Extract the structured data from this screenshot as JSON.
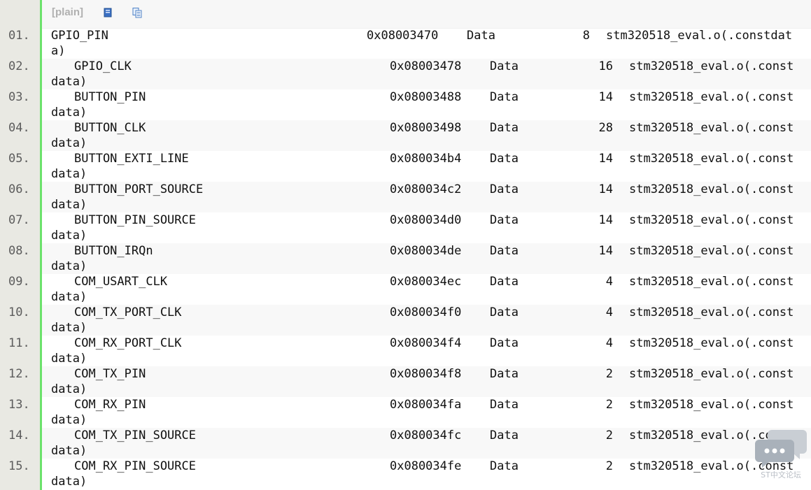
{
  "toolbar": {
    "label": "[plain]",
    "view_source_icon": "document-icon",
    "copy_icon": "copy-icon"
  },
  "lines": [
    {
      "num": "01.",
      "symbol": "GPIO_PIN",
      "addr": "0x08003470",
      "kind": "Data",
      "size": "8",
      "obj": "stm320518_eval.o(.constdat",
      "wrap": "a)"
    },
    {
      "num": "02.",
      "symbol": "GPIO_CLK",
      "addr": "0x08003478",
      "kind": "Data",
      "size": "16",
      "obj": "stm320518_eval.o(.const",
      "wrap": "data)"
    },
    {
      "num": "03.",
      "symbol": "BUTTON_PIN",
      "addr": "0x08003488",
      "kind": "Data",
      "size": "14",
      "obj": "stm320518_eval.o(.const",
      "wrap": "data)"
    },
    {
      "num": "04.",
      "symbol": "BUTTON_CLK",
      "addr": "0x08003498",
      "kind": "Data",
      "size": "28",
      "obj": "stm320518_eval.o(.const",
      "wrap": "data)"
    },
    {
      "num": "05.",
      "symbol": "BUTTON_EXTI_LINE",
      "addr": "0x080034b4",
      "kind": "Data",
      "size": "14",
      "obj": "stm320518_eval.o(.const",
      "wrap": "data)"
    },
    {
      "num": "06.",
      "symbol": "BUTTON_PORT_SOURCE",
      "addr": "0x080034c2",
      "kind": "Data",
      "size": "14",
      "obj": "stm320518_eval.o(.const",
      "wrap": "data)"
    },
    {
      "num": "07.",
      "symbol": "BUTTON_PIN_SOURCE",
      "addr": "0x080034d0",
      "kind": "Data",
      "size": "14",
      "obj": "stm320518_eval.o(.const",
      "wrap": "data)"
    },
    {
      "num": "08.",
      "symbol": "BUTTON_IRQn",
      "addr": "0x080034de",
      "kind": "Data",
      "size": "14",
      "obj": "stm320518_eval.o(.const",
      "wrap": "data)"
    },
    {
      "num": "09.",
      "symbol": "COM_USART_CLK",
      "addr": "0x080034ec",
      "kind": "Data",
      "size": "4",
      "obj": "stm320518_eval.o(.const",
      "wrap": "data)"
    },
    {
      "num": "10.",
      "symbol": "COM_TX_PORT_CLK",
      "addr": "0x080034f0",
      "kind": "Data",
      "size": "4",
      "obj": "stm320518_eval.o(.const",
      "wrap": "data)"
    },
    {
      "num": "11.",
      "symbol": "COM_RX_PORT_CLK",
      "addr": "0x080034f4",
      "kind": "Data",
      "size": "4",
      "obj": "stm320518_eval.o(.const",
      "wrap": "data)"
    },
    {
      "num": "12.",
      "symbol": "COM_TX_PIN",
      "addr": "0x080034f8",
      "kind": "Data",
      "size": "2",
      "obj": "stm320518_eval.o(.const",
      "wrap": "data)"
    },
    {
      "num": "13.",
      "symbol": "COM_RX_PIN",
      "addr": "0x080034fa",
      "kind": "Data",
      "size": "2",
      "obj": "stm320518_eval.o(.const",
      "wrap": "data)"
    },
    {
      "num": "14.",
      "symbol": "COM_TX_PIN_SOURCE",
      "addr": "0x080034fc",
      "kind": "Data",
      "size": "2",
      "obj": "stm320518_eval.o(.const",
      "wrap": "data)"
    },
    {
      "num": "15.",
      "symbol": "COM_RX_PIN_SOURCE",
      "addr": "0x080034fe",
      "kind": "Data",
      "size": "2",
      "obj": "stm320518_eval.o(.const",
      "wrap": "data)"
    }
  ],
  "watermark": {
    "text": "ST中文论坛",
    "icon": "chat-bubble-icon"
  },
  "colors": {
    "gutter": "#e9e9e3",
    "gutter_accent": "#6ce26c",
    "alt_row": "#f8f8f8",
    "text": "#111111"
  }
}
